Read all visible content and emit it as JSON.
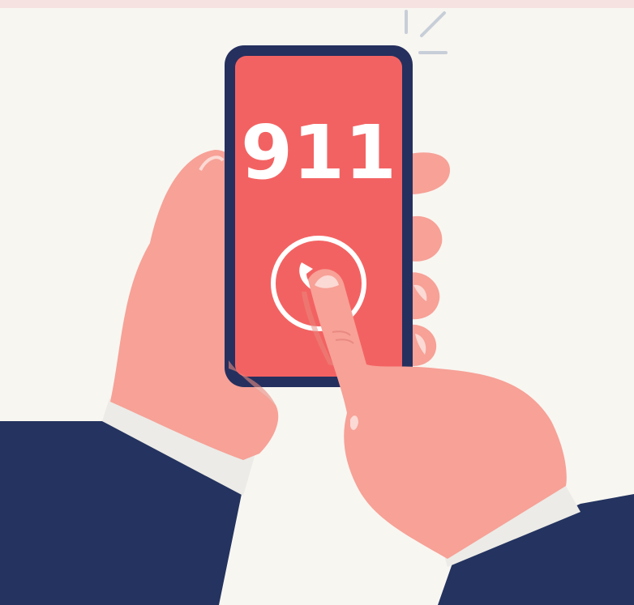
{
  "phone": {
    "screen_text": "911"
  },
  "colors": {
    "background": "#f8f6f1",
    "top_band": "#f6e2e0",
    "sleeve": "#24335f",
    "cuff": "#ecebe7",
    "skin": "#f7a197",
    "skin_shadow": "#e98a80",
    "phone_frame": "#25305e",
    "phone_screen": "#f36262",
    "screen_text": "#ffffff",
    "signal_lines": "#c7ced8"
  },
  "icons": [
    "phone-handset-icon",
    "signal-lines-icon"
  ]
}
